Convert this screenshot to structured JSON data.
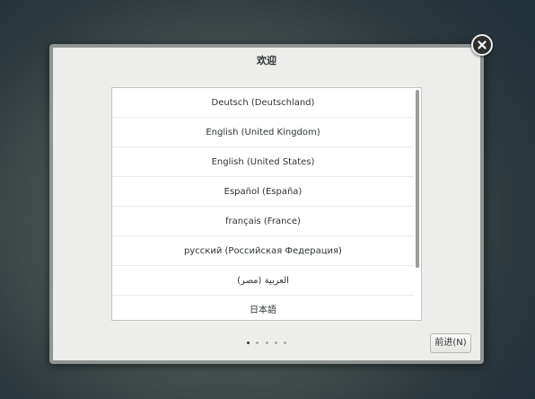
{
  "dialog": {
    "title": "欢迎",
    "languages": [
      {
        "label": "Deutsch (Deutschland)"
      },
      {
        "label": "English (United Kingdom)"
      },
      {
        "label": "English (United States)"
      },
      {
        "label": "Español (España)"
      },
      {
        "label": "français (France)"
      },
      {
        "label": "русский (Российская Федерация)"
      },
      {
        "label": "العربية (مصر)"
      },
      {
        "label": "日本語"
      }
    ],
    "pager": {
      "pages": 5,
      "current": 1
    },
    "next_label": "前进(N)"
  },
  "icons": {
    "close": "close-icon"
  }
}
